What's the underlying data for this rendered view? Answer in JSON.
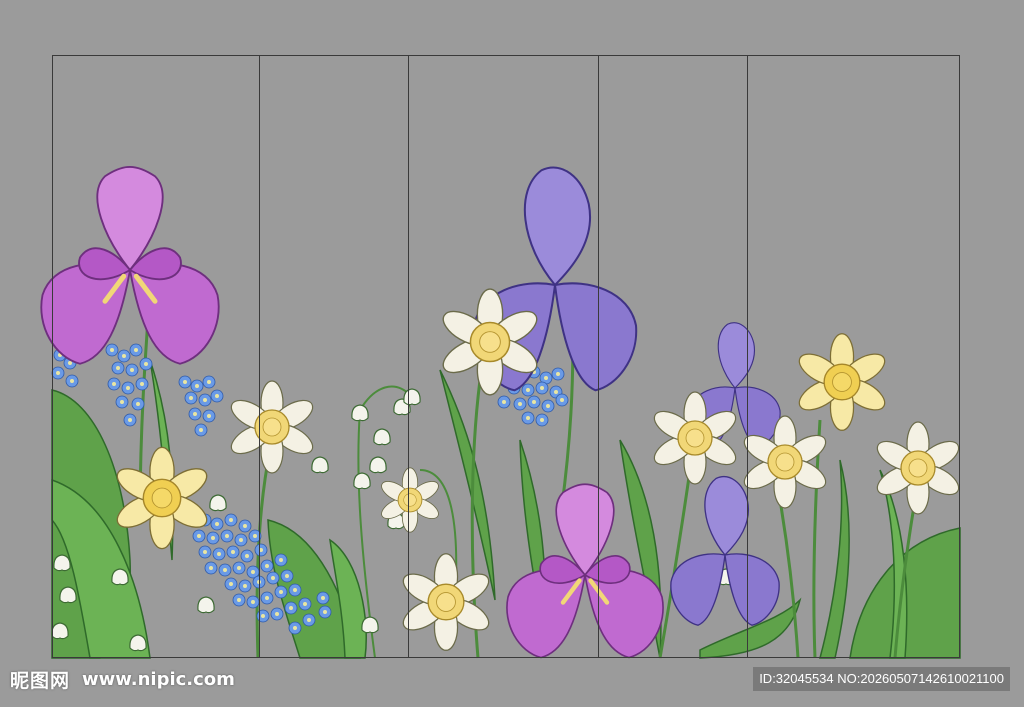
{
  "watermark": {
    "site_cn": "昵图网",
    "site_url": "www.nipic.com",
    "image_id": "ID:32045534 NO:20260507142610021100"
  },
  "colors": {
    "background": "#9b9b9b",
    "panel_line": "#3a3a3a",
    "leaf_green": "#5fa24a",
    "iris_pink": "#c06ad0",
    "iris_purple": "#8a78cf",
    "daffodil_white": "#f4f1e4",
    "daffodil_yellow": "#f1d777",
    "forget_me_not_blue": "#6a9ae6"
  },
  "artwork": {
    "panel_count": 5,
    "subjects": [
      "iris-pink",
      "iris-purple",
      "daffodil",
      "forget-me-not",
      "lily-of-the-valley",
      "leaves"
    ]
  }
}
